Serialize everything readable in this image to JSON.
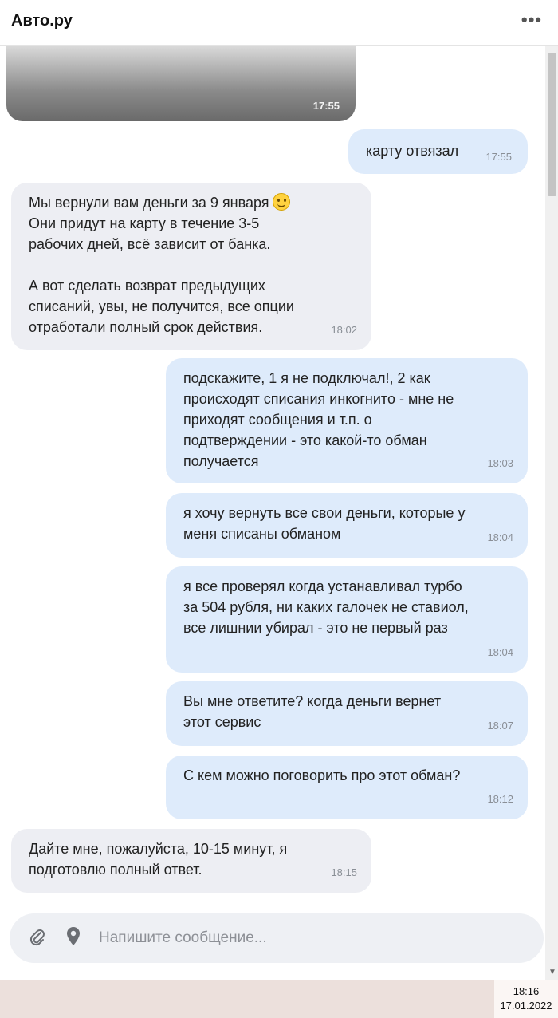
{
  "header": {
    "title": "Авто.ру",
    "more": "•••"
  },
  "image_message": {
    "time": "17:55"
  },
  "messages": [
    {
      "dir": "out",
      "text": "карту отвязал",
      "time": "17:55"
    },
    {
      "dir": "in",
      "text": "Мы вернули вам деньги за 9 января",
      "text_rest": "Они придут на карту в течение 3-5\nрабочих дней, всё зависит от банка.\n\nА вот сделать возврат предыдущих\nсписаний, увы, не получится, все опции\nотработали полный срок действия.",
      "emoji": "smiling-face-emoji",
      "time": "18:02"
    },
    {
      "dir": "out",
      "text": "подскажите, 1 я не подключал!, 2 как\nпроисходят списания инкогнито - мне не\nприходят сообщения и т.п. о\nподтверждении - это какой-то обман\nполучается",
      "time": "18:03"
    },
    {
      "dir": "out",
      "text": "я хочу вернуть все свои деньги, которые у\nменя списаны обманом",
      "time": "18:04"
    },
    {
      "dir": "out",
      "text": "я все проверял когда устанавливал турбо\nза 504 рубля, ни каких галочек не ставиол,\nвсе лишнии убирал - это не первый раз",
      "time": "18:04"
    },
    {
      "dir": "out",
      "text": "Вы мне ответите? когда деньги вернет\nэтот сервис",
      "time": "18:07"
    },
    {
      "dir": "out",
      "text": "С кем можно поговорить про этот обман?",
      "time": "18:12"
    },
    {
      "dir": "in",
      "text": "Дайте мне, пожалуйста, 10-15 минут, я\nподготовлю полный ответ.",
      "time": "18:15"
    }
  ],
  "composer": {
    "placeholder": "Напишите сообщение...",
    "attach_icon": "paperclip-icon",
    "location_icon": "location-pin-icon"
  },
  "taskbar": {
    "time": "18:16",
    "date": "17.01.2022"
  }
}
